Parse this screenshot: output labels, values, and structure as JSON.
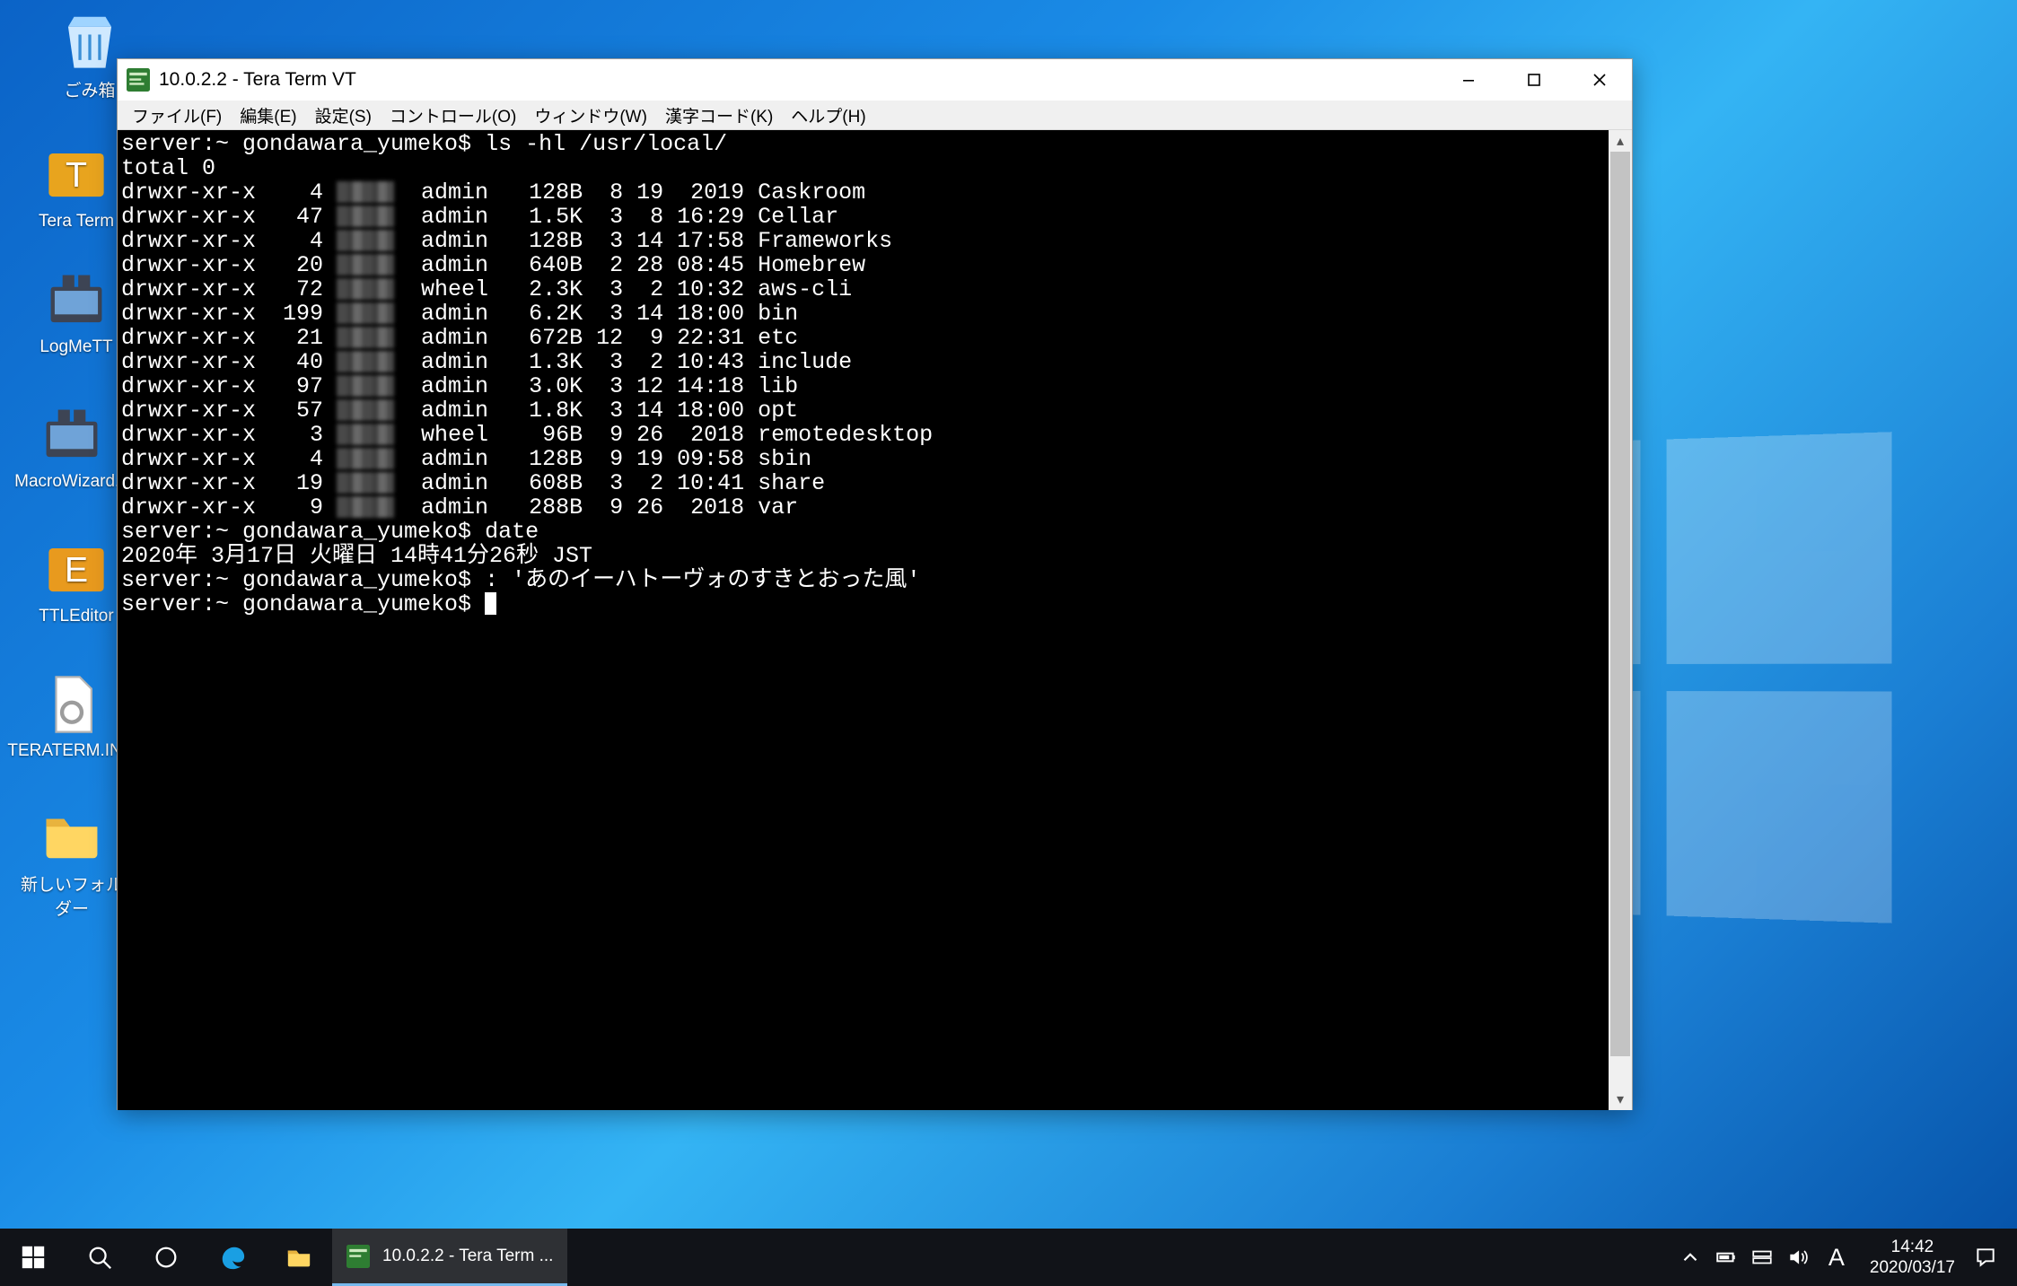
{
  "desktop_icons": {
    "recycle": "ごみ箱",
    "teraterm": "Tera Term",
    "logmett": "LogMeTT",
    "macrowiz": "MacroWizard...",
    "ttleditor": "TTLEditor",
    "teratermini": "TERATERM.IN...",
    "newfolder": "新しいフォルダー"
  },
  "window": {
    "title": "10.0.2.2 - Tera Term VT",
    "menu": {
      "file": "ファイル(F)",
      "edit": "編集(E)",
      "setup": "設定(S)",
      "control": "コントロール(O)",
      "window": "ウィンドウ(W)",
      "kanji": "漢字コード(K)",
      "help": "ヘルプ(H)"
    },
    "term": {
      "prompt1": "server:~ gondawara_yumeko$ ls -hl /usr/local/",
      "total": "total 0",
      "rows": [
        {
          "perm": "drwxr-xr-x",
          "n": "   4",
          "grp": "admin",
          "sz": "128B",
          "date": " 8 19  2019",
          "name": "Caskroom"
        },
        {
          "perm": "drwxr-xr-x",
          "n": "  47",
          "grp": "admin",
          "sz": "1.5K",
          "date": " 3  8 16:29",
          "name": "Cellar"
        },
        {
          "perm": "drwxr-xr-x",
          "n": "   4",
          "grp": "admin",
          "sz": "128B",
          "date": " 3 14 17:58",
          "name": "Frameworks"
        },
        {
          "perm": "drwxr-xr-x",
          "n": "  20",
          "grp": "admin",
          "sz": "640B",
          "date": " 2 28 08:45",
          "name": "Homebrew"
        },
        {
          "perm": "drwxr-xr-x",
          "n": "  72",
          "grp": "wheel",
          "sz": "2.3K",
          "date": " 3  2 10:32",
          "name": "aws-cli"
        },
        {
          "perm": "drwxr-xr-x",
          "n": " 199",
          "grp": "admin",
          "sz": "6.2K",
          "date": " 3 14 18:00",
          "name": "bin"
        },
        {
          "perm": "drwxr-xr-x",
          "n": "  21",
          "grp": "admin",
          "sz": "672B",
          "date": "12  9 22:31",
          "name": "etc"
        },
        {
          "perm": "drwxr-xr-x",
          "n": "  40",
          "grp": "admin",
          "sz": "1.3K",
          "date": " 3  2 10:43",
          "name": "include"
        },
        {
          "perm": "drwxr-xr-x",
          "n": "  97",
          "grp": "admin",
          "sz": "3.0K",
          "date": " 3 12 14:18",
          "name": "lib"
        },
        {
          "perm": "drwxr-xr-x",
          "n": "  57",
          "grp": "admin",
          "sz": "1.8K",
          "date": " 3 14 18:00",
          "name": "opt"
        },
        {
          "perm": "drwxr-xr-x",
          "n": "   3",
          "grp": "wheel",
          "sz": " 96B",
          "date": " 9 26  2018",
          "name": "remotedesktop"
        },
        {
          "perm": "drwxr-xr-x",
          "n": "   4",
          "grp": "admin",
          "sz": "128B",
          "date": " 9 19 09:58",
          "name": "sbin"
        },
        {
          "perm": "drwxr-xr-x",
          "n": "  19",
          "grp": "admin",
          "sz": "608B",
          "date": " 3  2 10:41",
          "name": "share"
        },
        {
          "perm": "drwxr-xr-x",
          "n": "   9",
          "grp": "admin",
          "sz": "288B",
          "date": " 9 26  2018",
          "name": "var"
        }
      ],
      "prompt2": "server:~ gondawara_yumeko$ date",
      "dateout": "2020年 3月17日 火曜日 14時41分26秒 JST",
      "prompt3": "server:~ gondawara_yumeko$ : 'あのイーハトーヴォのすきとおった風'",
      "prompt4": "server:~ gondawara_yumeko$ "
    }
  },
  "taskbar": {
    "task_title": "10.0.2.2 - Tera Term ...",
    "time": "14:42",
    "date": "2020/03/17",
    "ime": "A"
  }
}
